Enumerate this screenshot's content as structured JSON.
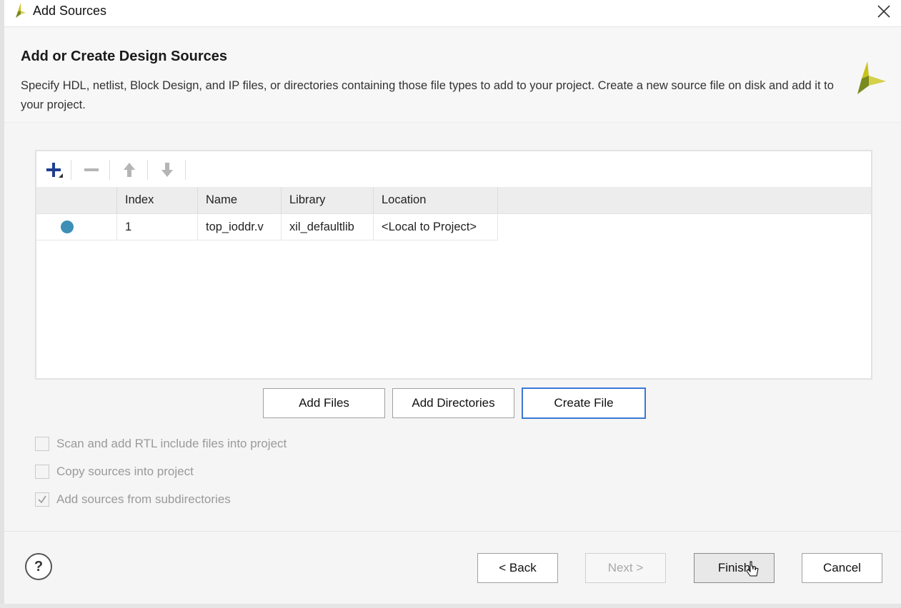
{
  "window": {
    "title": "Add Sources"
  },
  "header": {
    "title": "Add or Create Design Sources",
    "description": "Specify HDL, netlist, Block Design, and IP files, or directories containing those file types to add to your project. Create a new source file on disk and add it to your project."
  },
  "toolbar": {
    "add_icon": "plus-icon",
    "remove_icon": "minus-icon",
    "up_icon": "arrow-up-icon",
    "down_icon": "arrow-down-icon"
  },
  "table": {
    "columns": [
      "Index",
      "Name",
      "Library",
      "Location"
    ],
    "rows": [
      {
        "status": "dot",
        "index": "1",
        "name": "top_ioddr.v",
        "library": "xil_defaultlib",
        "location": "<Local to Project>"
      }
    ]
  },
  "actions": {
    "add_files": "Add Files",
    "add_directories": "Add Directories",
    "create_file": "Create File"
  },
  "options": [
    {
      "label": "Scan and add RTL include files into project",
      "checked": false,
      "enabled": false
    },
    {
      "label": "Copy sources into project",
      "checked": false,
      "enabled": false
    },
    {
      "label": "Add sources from subdirectories",
      "checked": true,
      "enabled": false
    }
  ],
  "footer": {
    "help": "?",
    "back": "< Back",
    "next": "Next >",
    "finish": "Finish",
    "cancel": "Cancel"
  },
  "colors": {
    "accent": "#3a78d6",
    "status_dot": "#3d8fb8",
    "brand_yellow": "#c9c21a",
    "brand_green": "#7a8a1e"
  }
}
